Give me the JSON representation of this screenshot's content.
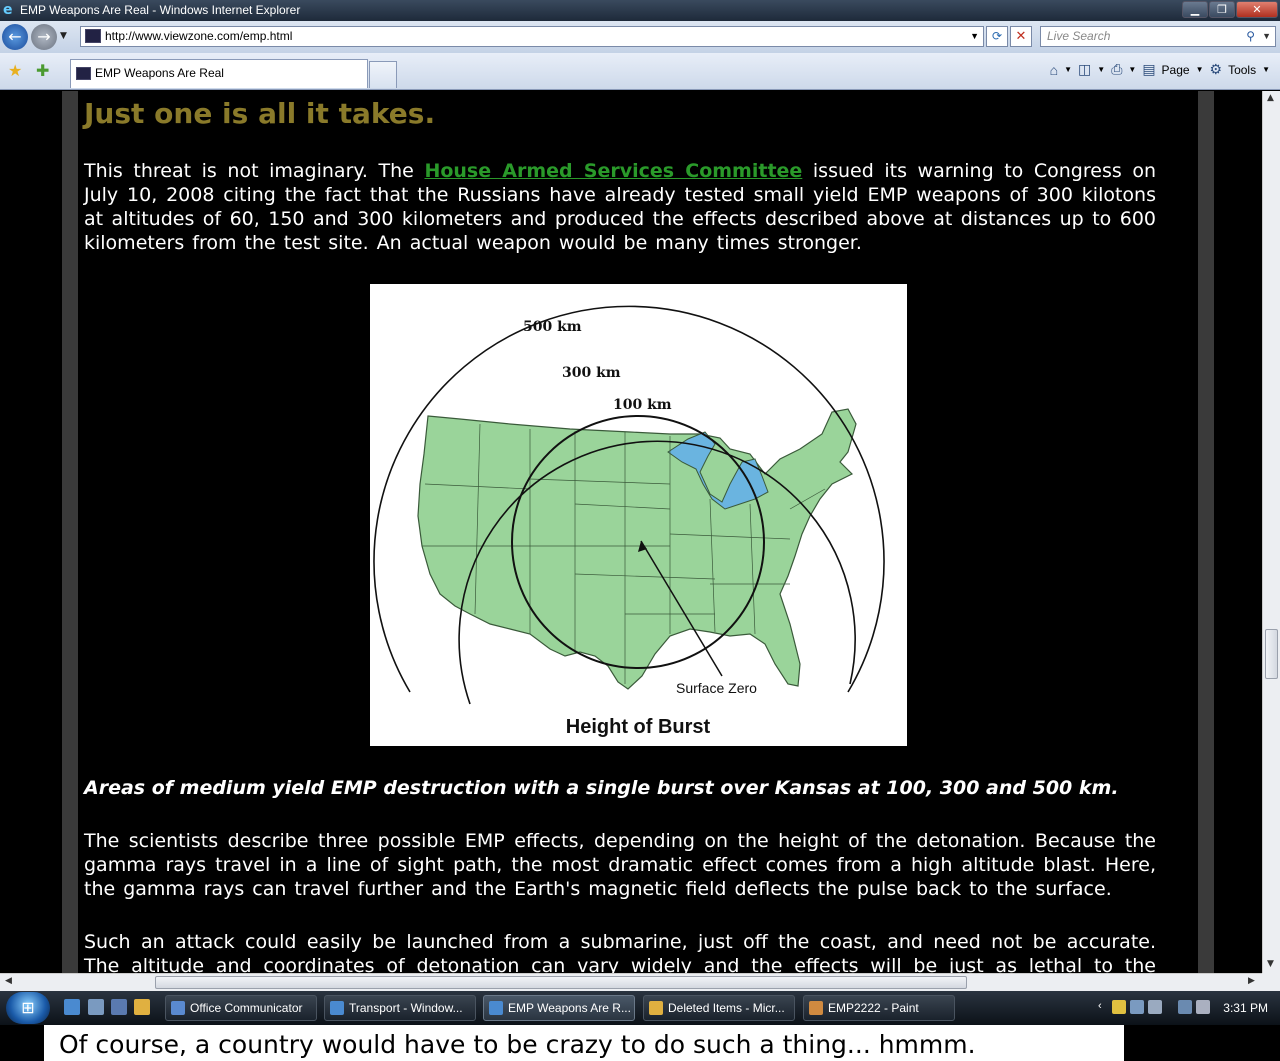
{
  "window": {
    "title": "EMP Weapons Are Real - Windows Internet Explorer"
  },
  "address_bar": {
    "url": "http://www.viewzone.com/emp.html",
    "search_placeholder": "Live Search"
  },
  "tabs": [
    {
      "label": "EMP Weapons Are Real"
    }
  ],
  "command_bar": {
    "page_label": "Page",
    "tools_label": "Tools"
  },
  "article": {
    "heading": "Just one is all it takes.",
    "p1_before_link": "This threat is not imaginary. The ",
    "p1_link": "House Armed Services Committee",
    "p1_after_link": " issued its warning to Congress on July 10, 2008 citing the fact that the Russians have already tested small yield EMP weapons of 300 kilotons at altitudes of 60, 150 and 300 kilometers and produced the effects described above at distances up to 600 kilometers from the test site. An actual weapon would be many times stronger.",
    "figure": {
      "ring_labels": [
        "500 km",
        "300 km",
        "100 km"
      ],
      "pointer_label": "Surface Zero",
      "title": "Height of Burst"
    },
    "caption": "Areas of medium yield EMP destruction with a single burst over Kansas at 100, 300 and 500 km.",
    "p2": "The scientists describe three possible EMP effects, depending on the height of the detonation. Because the gamma rays travel in a line of sight path, the most dramatic effect comes from a high altitude blast. Here, the gamma rays can travel further and the Earth's magnetic field deflects the pulse back to the surface.",
    "p3": "Such an attack could easily be launched from a submarine, just off the coast, and need not be accurate. The altitude and coordinates of detonation can vary widely and the effects will be just as lethal to the electronics."
  },
  "taskbar": {
    "buttons": [
      {
        "label": "Office Communicator"
      },
      {
        "label": "Transport - Window..."
      },
      {
        "label": "EMP Weapons Are R..."
      },
      {
        "label": "Deleted Items - Micr..."
      },
      {
        "label": "EMP2222 - Paint"
      }
    ],
    "clock": "3:31 PM"
  },
  "overlay_caption": "Of course, a country would have to be crazy to do such a thing... hmmm.",
  "colors": {
    "heading": "#8a7a2a",
    "link": "#2a9a2a",
    "map_land": "#9ad49a",
    "page_bg": "#000000"
  }
}
